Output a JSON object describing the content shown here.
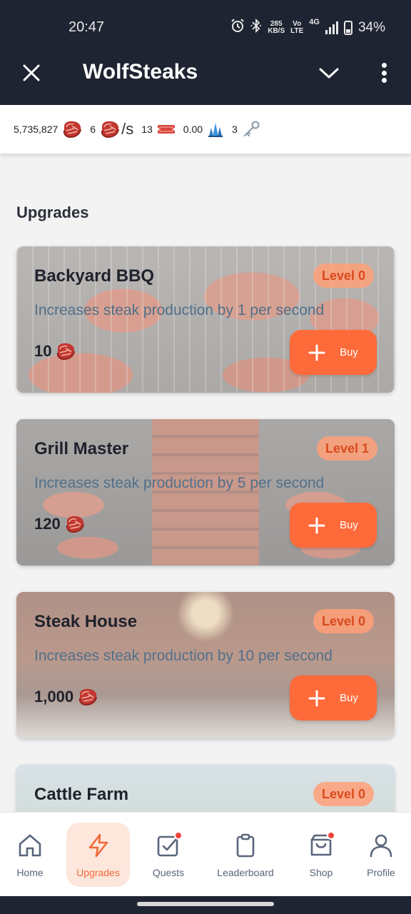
{
  "status_bar": {
    "time": "20:47",
    "net_speed_value": "285",
    "net_speed_unit": "KB/S",
    "volte_top": "Vo",
    "volte_bottom": "LTE",
    "network": "4G",
    "battery": "34%"
  },
  "app": {
    "title": "WolfSteaks"
  },
  "resources": {
    "steaks": "5,735,827",
    "per_second_value": "6",
    "per_second_unit": "/s",
    "tickets": "13",
    "crystals": "0.00",
    "keys": "3"
  },
  "section_title": "Upgrades",
  "upgrades": [
    {
      "name": "Backyard BBQ",
      "level": "Level 0",
      "description": "Increases steak production by 1 per second",
      "price": "10",
      "buy_label": "Buy"
    },
    {
      "name": "Grill Master",
      "level": "Level 1",
      "description": "Increases steak production by 5 per second",
      "price": "120",
      "buy_label": "Buy"
    },
    {
      "name": "Steak House",
      "level": "Level 0",
      "description": "Increases steak production by 10 per second",
      "price": "1,000",
      "buy_label": "Buy"
    },
    {
      "name": "Cattle Farm",
      "level": "Level 0"
    }
  ],
  "nav": [
    {
      "label": "Home",
      "icon": "home-icon"
    },
    {
      "label": "Upgrades",
      "icon": "bolt-icon",
      "active": true
    },
    {
      "label": "Quests",
      "icon": "quests-icon",
      "badge": true
    },
    {
      "label": "Leaderboard",
      "icon": "clipboard-icon"
    },
    {
      "label": "Shop",
      "icon": "shopping-bag-icon",
      "badge": true
    },
    {
      "label": "Profile",
      "icon": "user-icon"
    }
  ],
  "colors": {
    "header_bg": "#1e2431",
    "accent": "#ff6a3a",
    "level_text": "#d94a1e",
    "nav_active_bg": "#fde6dc"
  }
}
